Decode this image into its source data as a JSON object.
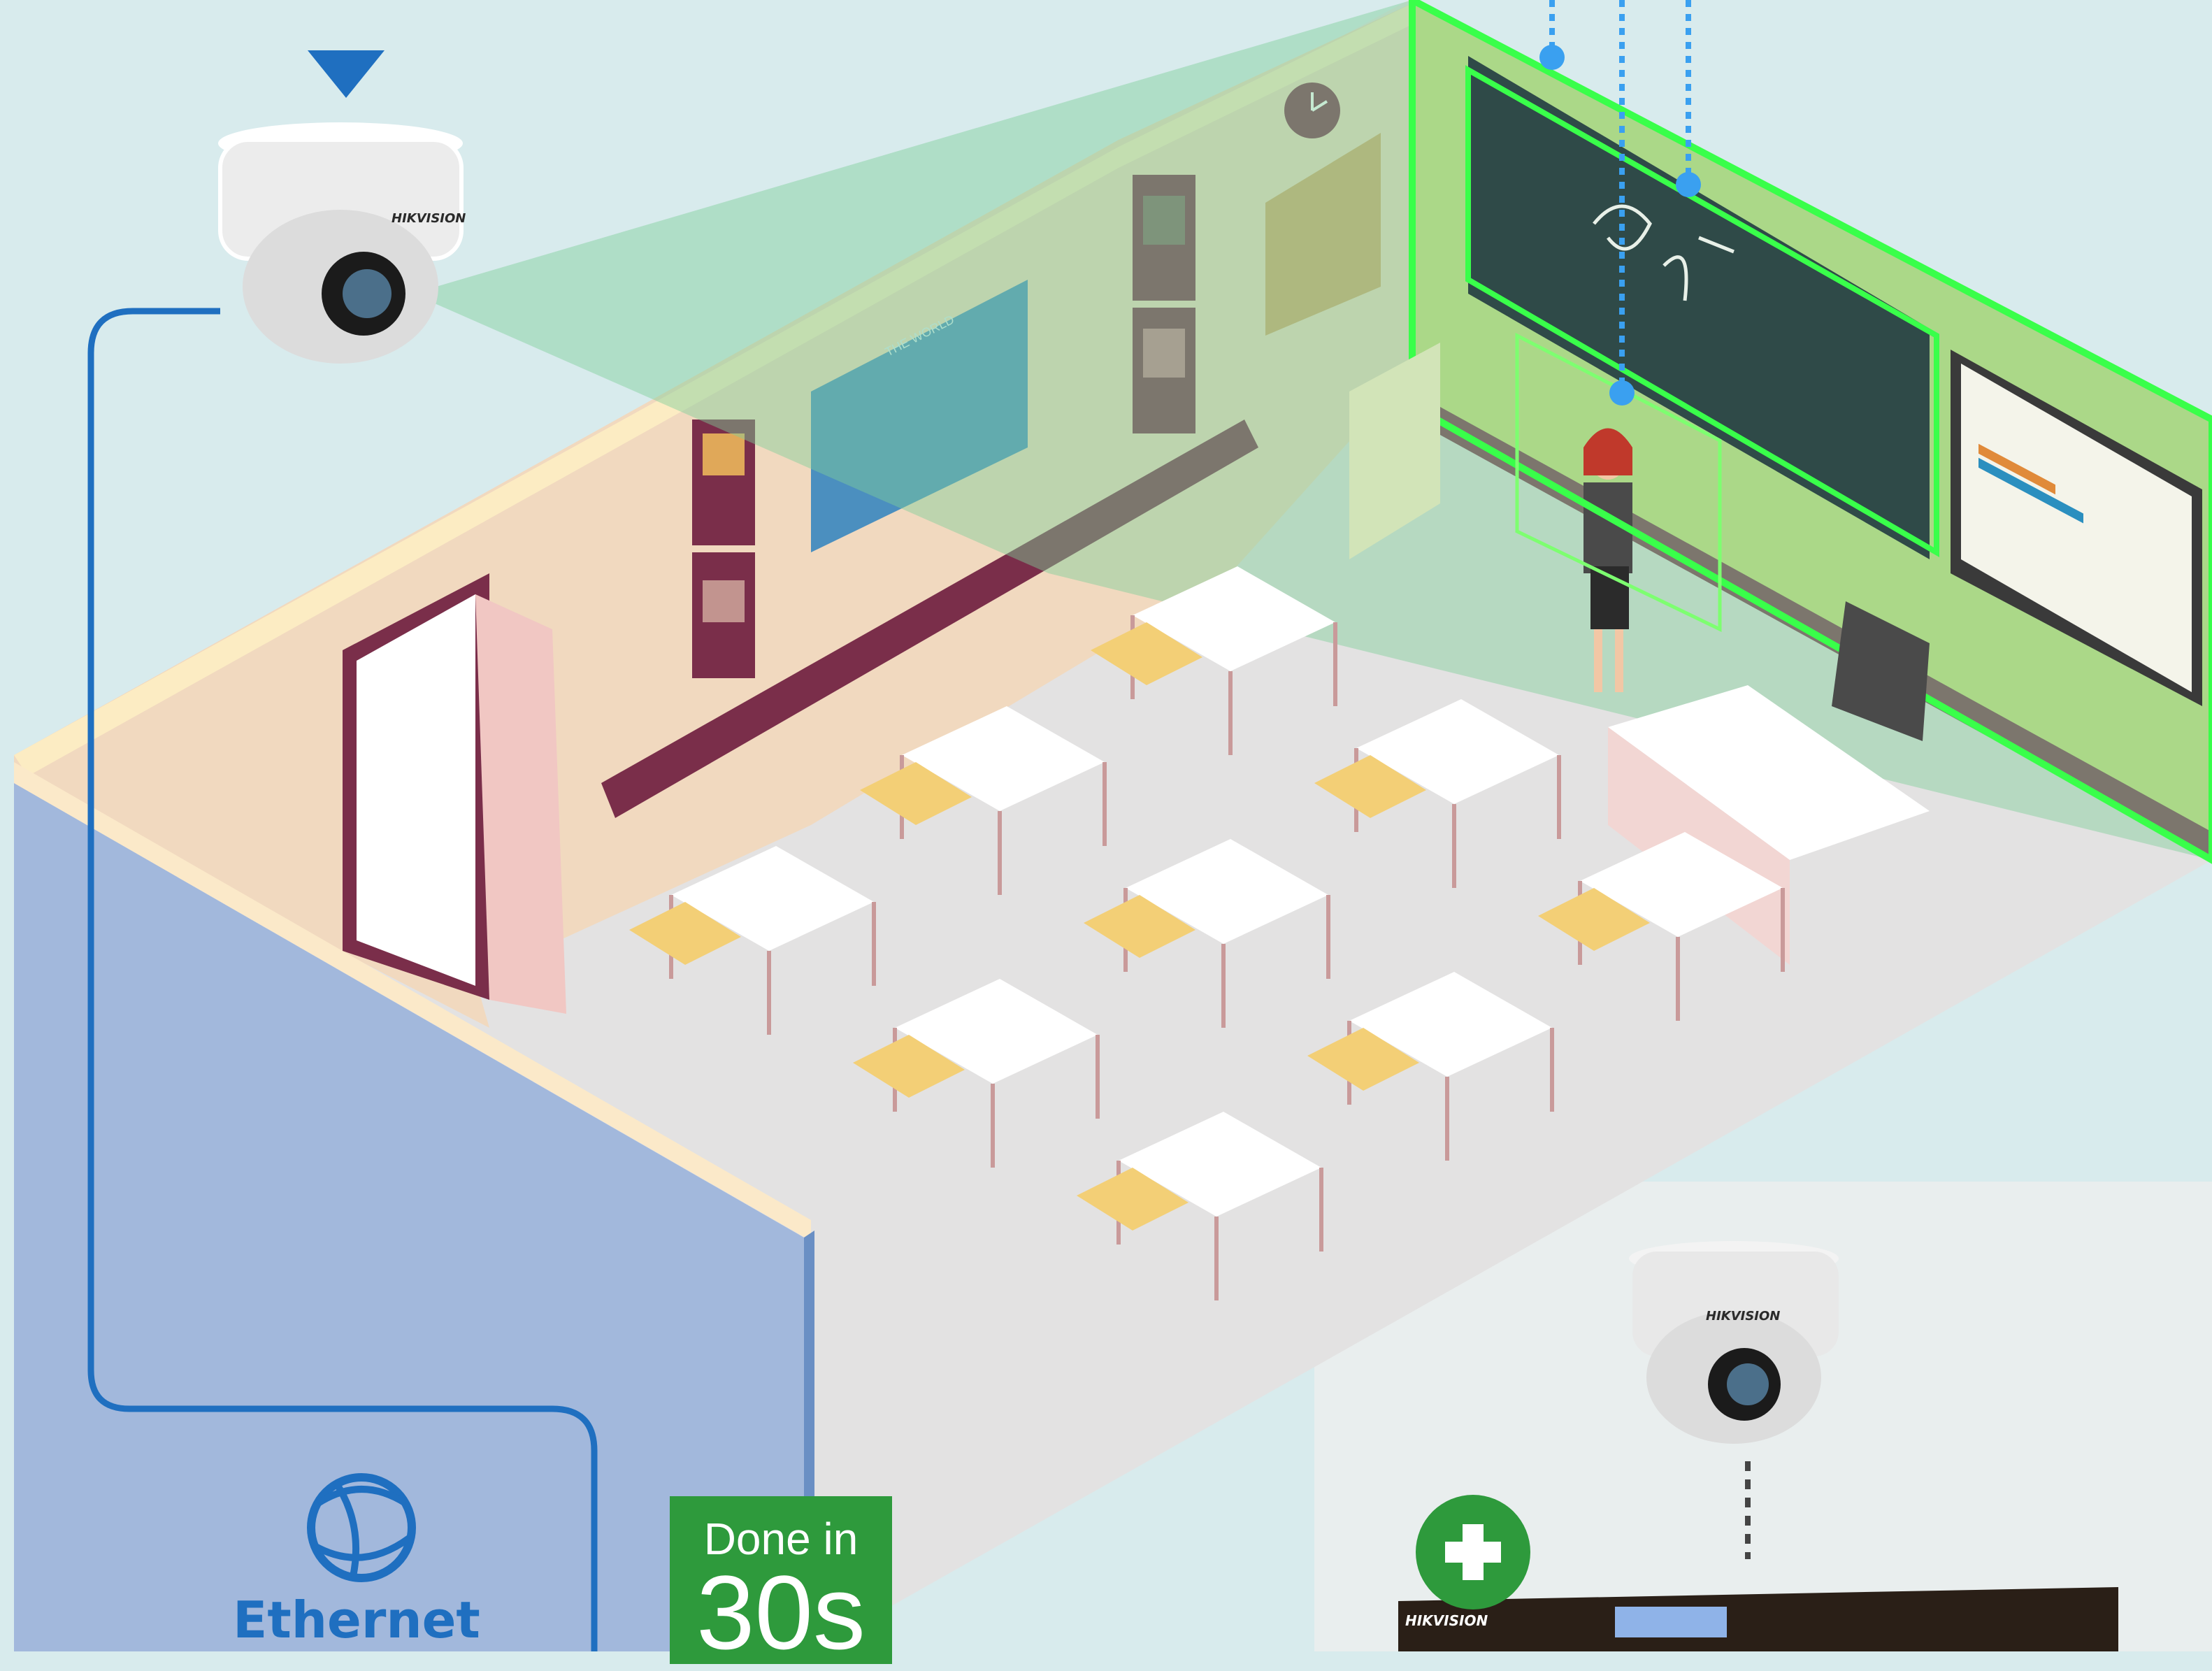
{
  "camera_main": {
    "brand": "HIKVISION"
  },
  "camera_secondary": {
    "brand": "HIKVISION"
  },
  "nvr": {
    "brand": "HIKVISION"
  },
  "map_caption": "THE WORLD",
  "monitor_brand": "HIKVISION",
  "ethernet": {
    "label": "Ethernet"
  },
  "badge": {
    "line1": "Done in",
    "line2": "30s"
  },
  "colors": {
    "background": "#d8ebed",
    "accent_blue": "#1f6fc0",
    "detection_green": "#39ff4a",
    "badge_green": "#2e9a3c",
    "chalkboard": "#2f4a48"
  }
}
